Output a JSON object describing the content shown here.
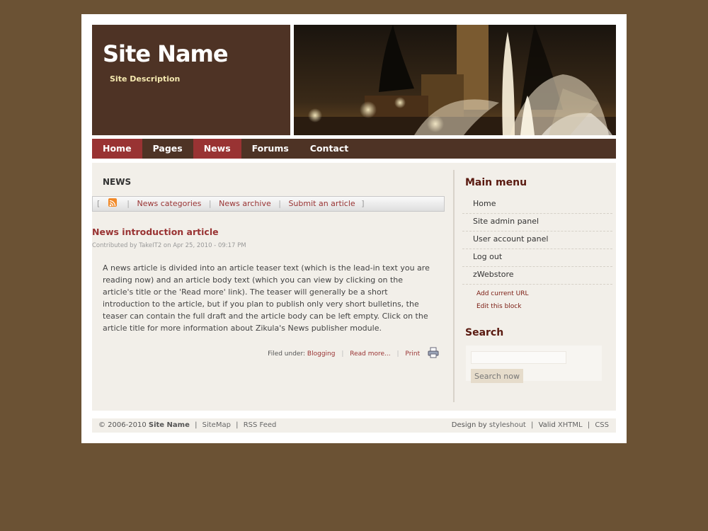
{
  "header": {
    "site_name": "Site Name",
    "site_description": "Site Description"
  },
  "nav": {
    "items": [
      {
        "label": "Home",
        "active": true
      },
      {
        "label": "Pages",
        "active": false
      },
      {
        "label": "News",
        "active": true
      },
      {
        "label": "Forums",
        "active": false
      },
      {
        "label": "Contact",
        "active": false
      }
    ]
  },
  "main": {
    "section_title": "NEWS",
    "news_bar": {
      "open_bracket": "[",
      "close_bracket": "]",
      "separator": "|",
      "links": [
        "News categories",
        "News archive",
        "Submit an article"
      ]
    },
    "article": {
      "title": "News introduction article",
      "byline": "Contributed by TakeIT2 on Apr 25, 2010 - 09:17 PM",
      "body": "A news article is divided into an article teaser text (which is the lead-in text you are reading now) and an article body text (which you can view by clicking on the article's title or the 'Read more' link). The teaser will generally be a short introduction to the article, but if you plan to publish only very short bulletins, the teaser can contain the full draft and the article body can be left empty. Click on the article title for more information about Zikula's News publisher module.",
      "filed_under_label": "Filed under:",
      "category": "Blogging",
      "read_more": "Read more...",
      "print": "Print"
    }
  },
  "sidebar": {
    "main_menu": {
      "title": "Main menu",
      "items": [
        "Home",
        "Site admin panel",
        "User account panel",
        "Log out",
        "zWebstore"
      ],
      "admin_links": [
        "Add current URL",
        "Edit this block"
      ]
    },
    "search": {
      "title": "Search",
      "input_value": "",
      "button_label": "Search now"
    }
  },
  "footer": {
    "copyright": "© 2006-2010",
    "site_name": "Site Name",
    "separator": "|",
    "links_left": [
      "SiteMap",
      "RSS Feed"
    ],
    "design_by": "Design by",
    "designer": "styleshout",
    "valid_label": "Valid",
    "xhtml": "XHTML",
    "css": "CSS"
  },
  "colors": {
    "background": "#6b5234",
    "header_brown": "#4e3325",
    "accent_red": "#993333",
    "content_bg": "#f2efe9",
    "sidebar_heading": "#5a1a10"
  },
  "icons": {
    "rss": "rss-feed-icon",
    "print": "printer-icon"
  }
}
